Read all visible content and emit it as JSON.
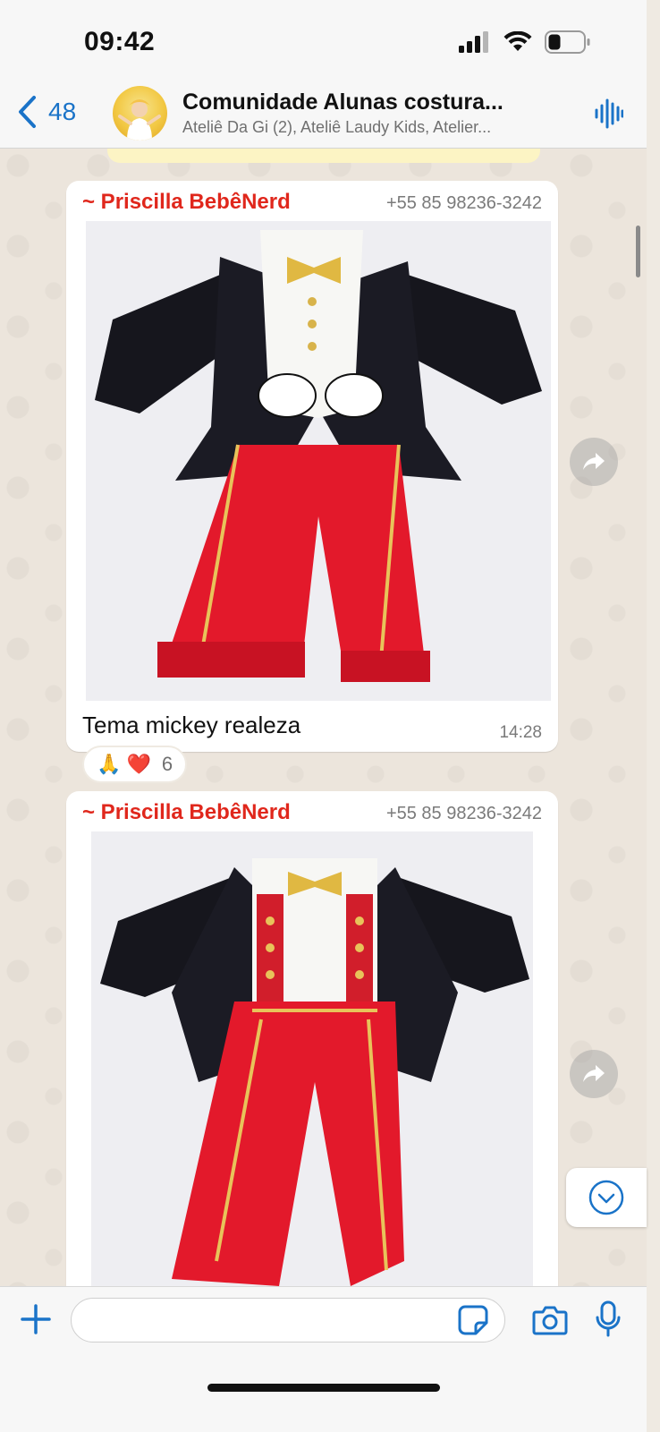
{
  "status_bar": {
    "time": "09:42"
  },
  "header": {
    "back_count": "48",
    "title": "Comunidade Alunas  costura...",
    "subtitle": "Ateliê Da Gi (2), Ateliê Laudy Kids, Atelier..."
  },
  "messages": [
    {
      "sender": "~ Priscilla BebêNerd",
      "phone": "+55 85 98236-3242",
      "caption": "Tema mickey realeza",
      "time": "14:28",
      "reactions": {
        "emojis": "🙏 ❤️",
        "count": "6"
      }
    },
    {
      "sender": "~ Priscilla BebêNerd",
      "phone": "+55 85 98236-3242"
    }
  ],
  "input": {
    "placeholder": ""
  },
  "colors": {
    "sender": "#e0271c",
    "accent": "#1a73c8",
    "bubble": "#ffffff",
    "background": "#efeae2"
  },
  "icons": [
    "back-chevron-icon",
    "audio-call-icon",
    "forward-icon",
    "chevron-down-icon",
    "plus-icon",
    "sticker-icon",
    "camera-icon",
    "microphone-icon"
  ]
}
